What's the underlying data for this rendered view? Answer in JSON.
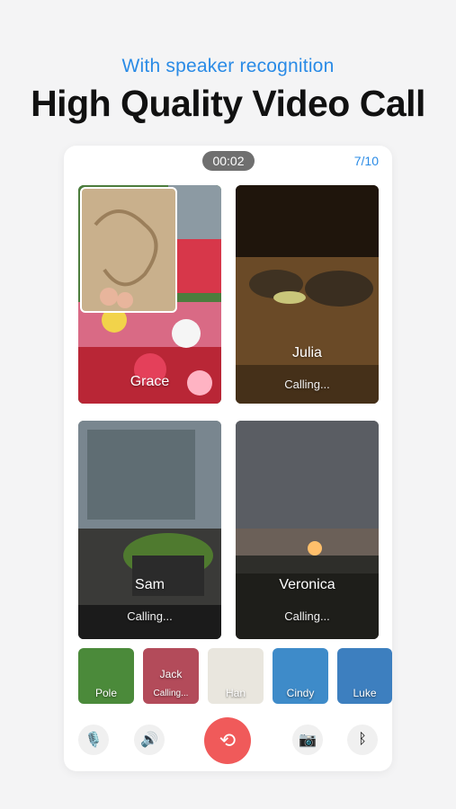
{
  "header": {
    "subtitle": "With speaker recognition",
    "title": "High Quality Video Call"
  },
  "call": {
    "timer": "00:02",
    "participant_count": "7/10"
  },
  "tiles": [
    {
      "name": "Grace",
      "status": ""
    },
    {
      "name": "Julia",
      "status": "Calling..."
    },
    {
      "name": "Sam",
      "status": "Calling..."
    },
    {
      "name": "Veronica",
      "status": "Calling..."
    }
  ],
  "thumbnails": [
    {
      "name": "Pole",
      "status": ""
    },
    {
      "name": "Jack",
      "status": "Calling..."
    },
    {
      "name": "Han",
      "status": ""
    },
    {
      "name": "Cindy",
      "status": ""
    },
    {
      "name": "Luke",
      "status": ""
    }
  ],
  "controls": {
    "icons": [
      "mic-muted-icon",
      "speaker-icon",
      "end-call-icon",
      "camera-switch-icon",
      "bluetooth-icon"
    ],
    "end_call_color": "#f05a5a",
    "accent_color": "#2a8be6"
  }
}
